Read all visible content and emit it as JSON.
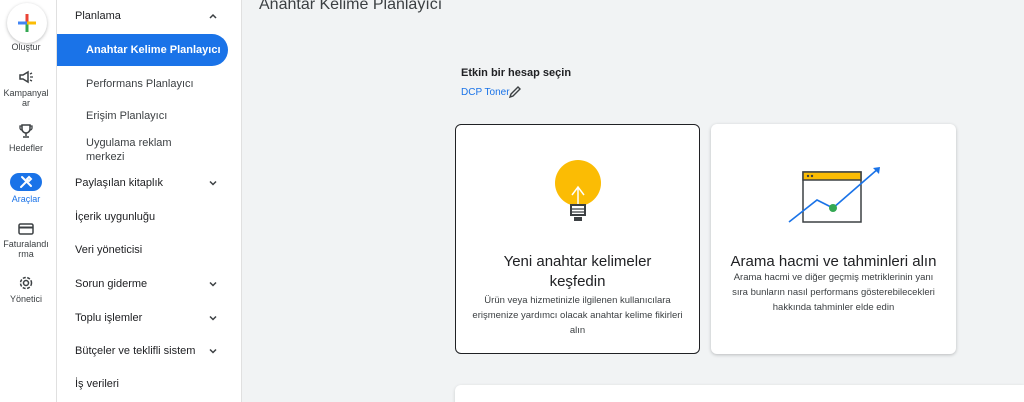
{
  "rail": {
    "create_label": "Oluştur",
    "items": [
      {
        "label": "Kampanyal ar",
        "icon": "megaphone-icon"
      },
      {
        "label": "Hedefler",
        "icon": "trophy-icon"
      },
      {
        "label": "Araçlar",
        "icon": "tools-icon",
        "active": true
      },
      {
        "label": "Faturalandı rma",
        "icon": "credit-card-icon"
      },
      {
        "label": "Yönetici",
        "icon": "gear-icon"
      }
    ]
  },
  "nav": {
    "planning": "Planlama",
    "keyword_planner": "Anahtar Kelime Planlayıcı",
    "performance_planner": "Performans Planlayıcı",
    "reach_planner": "Erişim Planlayıcı",
    "app_ad_center": "Uygulama reklam merkezi",
    "shared_library": "Paylaşılan kitaplık",
    "content_suitability": "İçerik uygunluğu",
    "data_manager": "Veri yöneticisi",
    "troubleshooting": "Sorun giderme",
    "bulk_actions": "Toplu işlemler",
    "budgets_bidding": "Bütçeler ve teklifli sistem",
    "business_data": "İş verileri"
  },
  "main": {
    "title": "Anahtar Kelime Planlayıcı",
    "account_label": "Etkin bir hesap seçin",
    "account_name": "DCP Toner"
  },
  "cards": [
    {
      "title": "Yeni anahtar kelimeler keşfedin",
      "description": "Ürün veya hizmetinizle ilgilenen kullanıcılara erişmenize yardımcı olacak anahtar kelime fikirleri alın",
      "icon": "lightbulb-icon"
    },
    {
      "title": "Arama hacmi ve tahminleri alın",
      "description": "Arama hacmi ve diğer geçmiş metriklerinin yanı sıra bunların nasıl performans gösterebilecekleri hakkında tahminler elde edin",
      "icon": "trend-chart-icon"
    }
  ],
  "colors": {
    "accent": "#1a73e8",
    "bulb": "#fbbc04"
  }
}
